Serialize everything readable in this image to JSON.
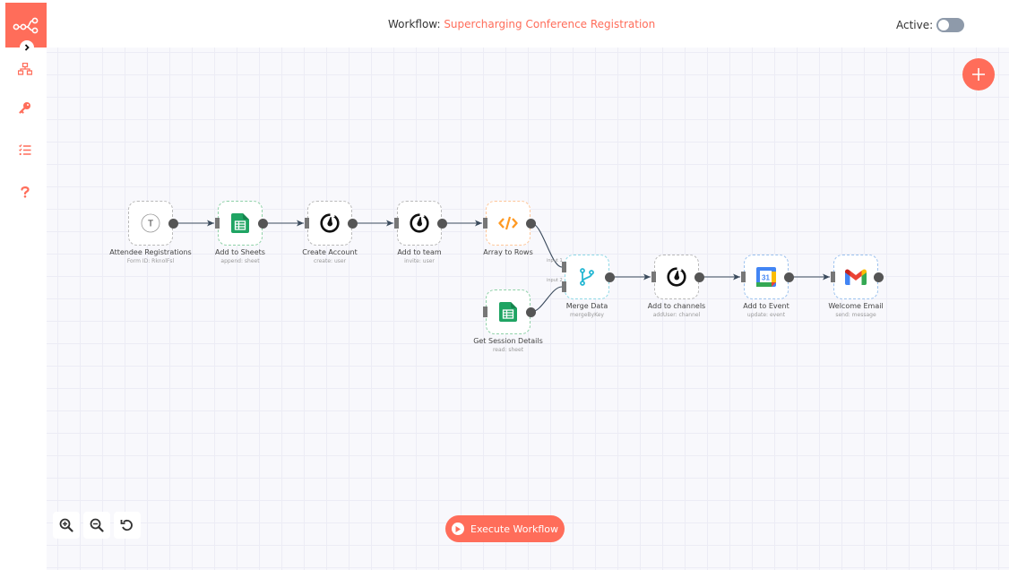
{
  "header": {
    "workflow_prefix": "Workflow: ",
    "workflow_name": "Supercharging Conference Registration",
    "active_label": "Active:",
    "active": false
  },
  "sidebar": {
    "items": [
      {
        "name": "workflows",
        "icon": "network-icon"
      },
      {
        "name": "credentials",
        "icon": "key-icon"
      },
      {
        "name": "executions",
        "icon": "tasks-icon"
      },
      {
        "name": "help",
        "icon": "question-icon"
      }
    ]
  },
  "colors": {
    "brand": "#ff6d5a",
    "canvas": "#f8f8fc",
    "edge": "#3a4a5c",
    "port": "#555555"
  },
  "nodes": [
    {
      "id": "attendee",
      "label": "Attendee Registrations",
      "sub": "Form ID: RknolFsl",
      "icon": "typeform-icon"
    },
    {
      "id": "sheets1",
      "label": "Add to Sheets",
      "sub": "append: sheet",
      "icon": "google-sheets-icon"
    },
    {
      "id": "create",
      "label": "Create Account",
      "sub": "create: user",
      "icon": "mattermost-icon"
    },
    {
      "id": "team",
      "label": "Add to team",
      "sub": "invite: user",
      "icon": "mattermost-icon"
    },
    {
      "id": "array",
      "label": "Array to Rows",
      "sub": "",
      "icon": "code-icon"
    },
    {
      "id": "session",
      "label": "Get Session Details",
      "sub": "read: sheet",
      "icon": "google-sheets-icon"
    },
    {
      "id": "merge",
      "label": "Merge Data",
      "sub": "mergeByKey",
      "icon": "merge-icon"
    },
    {
      "id": "channels",
      "label": "Add to channels",
      "sub": "addUser: channel",
      "icon": "mattermost-icon"
    },
    {
      "id": "event",
      "label": "Add to Event",
      "sub": "update: event",
      "icon": "google-calendar-icon"
    },
    {
      "id": "email",
      "label": "Welcome Email",
      "sub": "send: message",
      "icon": "gmail-icon"
    }
  ],
  "merge_inputs": [
    "input 1",
    "input 2"
  ],
  "calendar_day": "31",
  "typeform_letter": "T",
  "controls": {
    "zoom_in": "zoom-in",
    "zoom_out": "zoom-out",
    "reset": "reset-zoom",
    "execute_label": "Execute Workflow"
  }
}
